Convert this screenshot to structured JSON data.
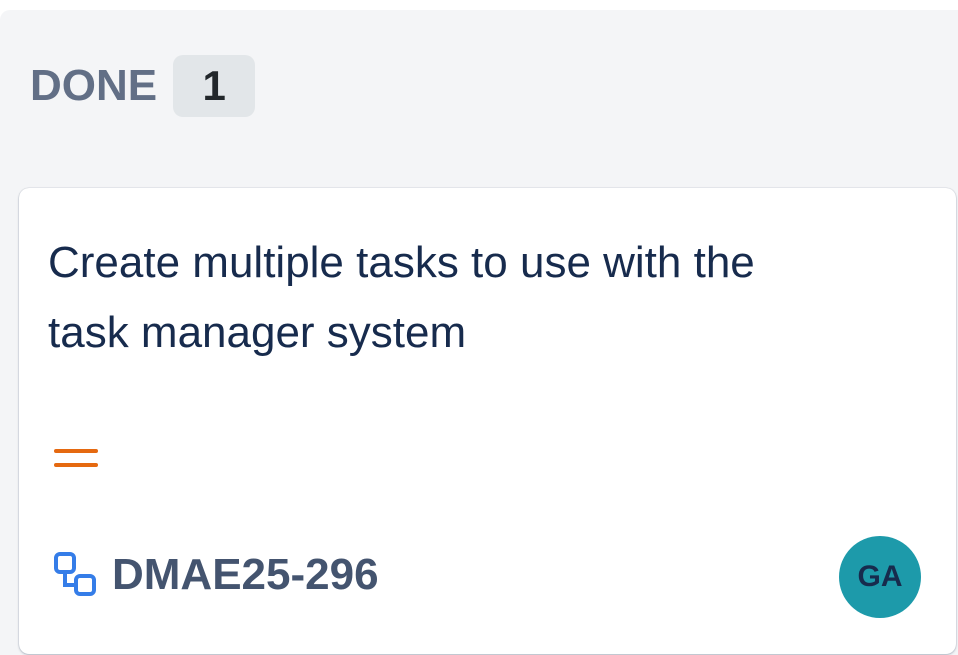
{
  "column": {
    "title": "DONE",
    "count": "1"
  },
  "card": {
    "summary": "Create multiple tasks to use with the task manager system",
    "priority_icon": "priority-medium-icon",
    "type_icon": "subtask-icon",
    "issue_key": "DMAE25-296",
    "assignee_initials": "GA"
  },
  "colors": {
    "column_bg": "#f4f5f7",
    "badge_bg": "#e2e6e9",
    "priority": "#e56910",
    "subtask_icon": "#357de8",
    "avatar_bg": "#1d9aaa"
  }
}
